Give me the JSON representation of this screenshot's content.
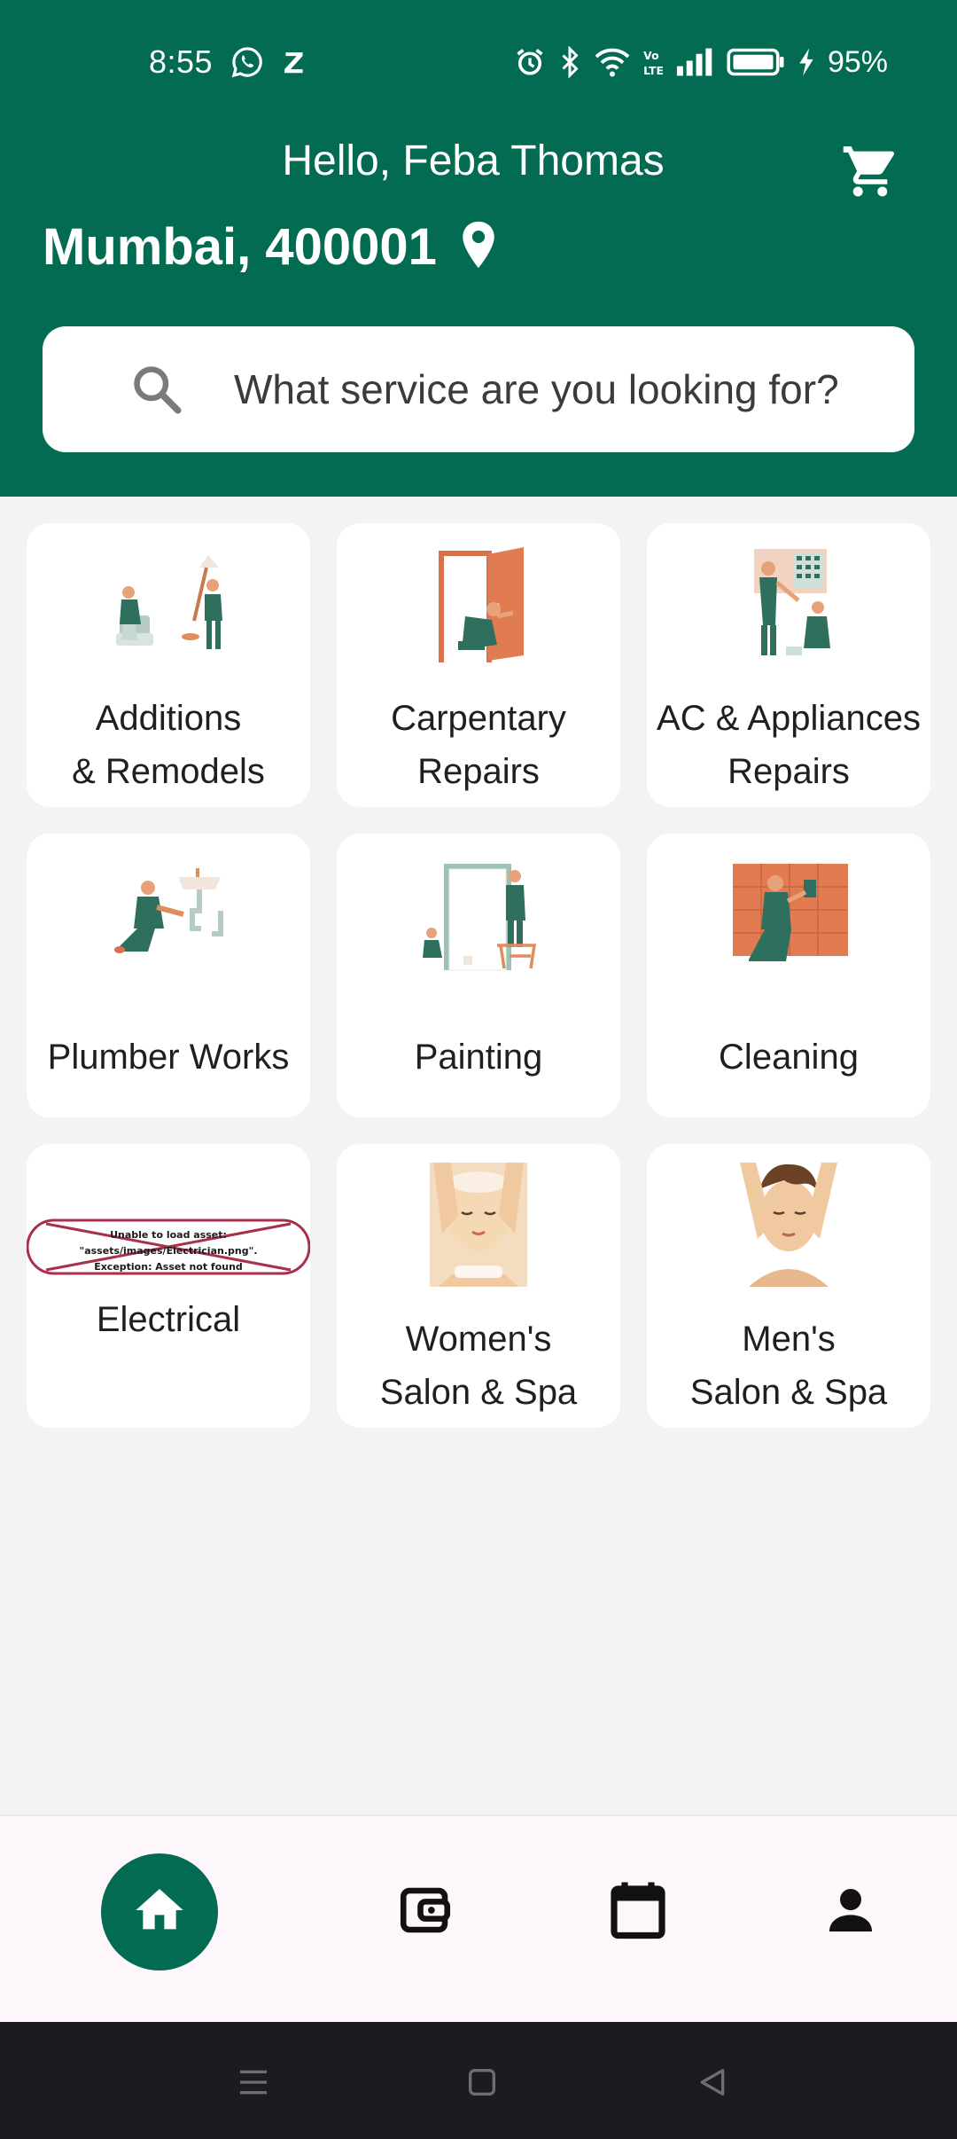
{
  "status_bar": {
    "time": "8:55",
    "battery_percent": "95%",
    "left_icons": [
      "whatsapp-icon",
      "z-app-icon"
    ],
    "right_icons": [
      "alarm-icon",
      "bluetooth-icon",
      "wifi-icon",
      "volte-icon",
      "signal-icon",
      "battery-icon",
      "charging-icon"
    ]
  },
  "header": {
    "greeting": "Hello, Feba Thomas",
    "location": "Mumbai, 400001",
    "cart_icon": "cart-icon",
    "location_icon": "location-pin-icon",
    "background_color": "#036b51"
  },
  "search": {
    "placeholder": "What service are you looking for?",
    "value": "",
    "icon": "search-icon"
  },
  "services": [
    {
      "label": "Additions\n& Remodels"
    },
    {
      "label": "Carpentary\nRepairs"
    },
    {
      "label": "AC & Appliances\nRepairs"
    },
    {
      "label": "Plumber Works"
    },
    {
      "label": "Painting"
    },
    {
      "label": "Cleaning"
    },
    {
      "label": "Electrical",
      "image_error": "Unable to load asset: \"assets/images/Electrician.png\".\nException: Asset not found"
    },
    {
      "label": "Women's\nSalon & Spa"
    },
    {
      "label": "Men's\nSalon & Spa"
    }
  ],
  "bottom_nav": {
    "items": [
      "home-icon",
      "wallet-icon",
      "calendar-icon",
      "profile-icon"
    ],
    "active": "home-icon",
    "accent_color": "#036b51"
  },
  "system_nav": {
    "buttons": [
      "menu-icon",
      "home-square-icon",
      "back-triangle-icon"
    ]
  }
}
